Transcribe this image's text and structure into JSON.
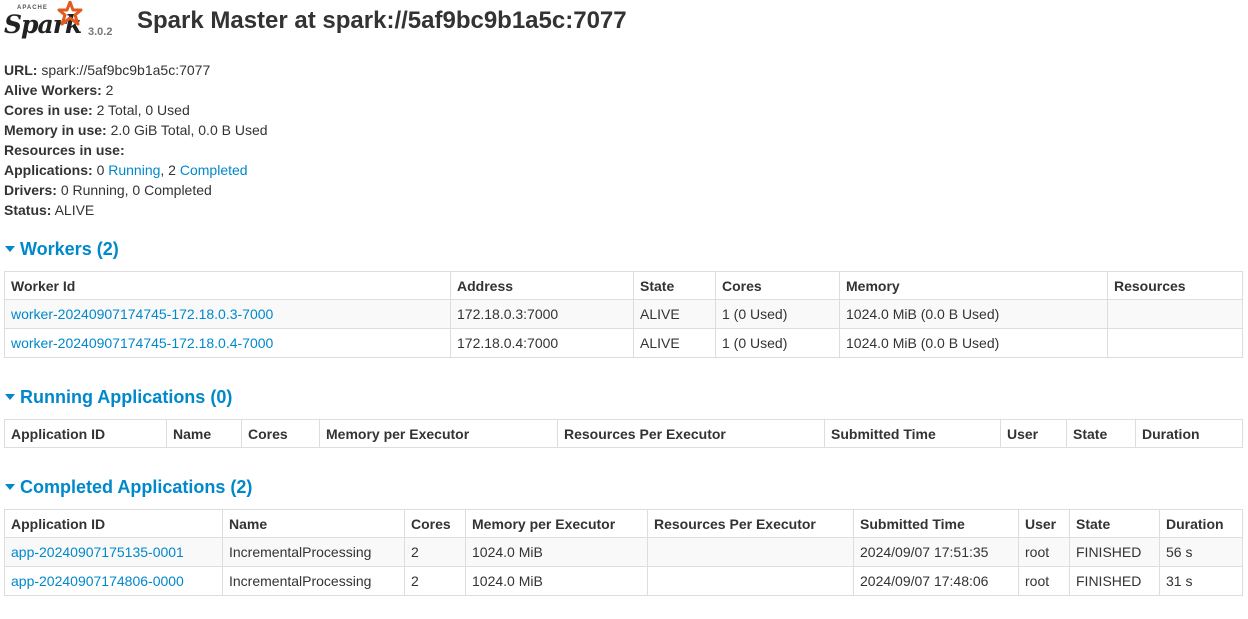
{
  "header": {
    "logo_top": "APACHE",
    "logo_word": "Spark",
    "version": "3.0.2",
    "title": "Spark Master at spark://5af9bc9b1a5c:7077"
  },
  "summary": {
    "url_label": "URL:",
    "url_value": "spark://5af9bc9b1a5c:7077",
    "workers_label": "Alive Workers:",
    "workers_value": "2",
    "cores_label": "Cores in use:",
    "cores_value": "2 Total, 0 Used",
    "memory_label": "Memory in use:",
    "memory_value": "2.0 GiB Total, 0.0 B Used",
    "resources_label": "Resources in use:",
    "apps_label": "Applications:",
    "apps_running_count": "0",
    "apps_running_link": "Running",
    "apps_sep": ", 2",
    "apps_completed_link": "Completed",
    "drivers_label": "Drivers:",
    "drivers_value": "0 Running, 0 Completed",
    "status_label": "Status:",
    "status_value": "ALIVE"
  },
  "workers": {
    "title": "Workers (2)",
    "columns": [
      "Worker Id",
      "Address",
      "State",
      "Cores",
      "Memory",
      "Resources"
    ],
    "rows": [
      [
        "worker-20240907174745-172.18.0.3-7000",
        "172.18.0.3:7000",
        "ALIVE",
        "1 (0 Used)",
        "1024.0 MiB (0.0 B Used)",
        ""
      ],
      [
        "worker-20240907174745-172.18.0.4-7000",
        "172.18.0.4:7000",
        "ALIVE",
        "1 (0 Used)",
        "1024.0 MiB (0.0 B Used)",
        ""
      ]
    ]
  },
  "running": {
    "title": "Running Applications (0)",
    "columns": [
      "Application ID",
      "Name",
      "Cores",
      "Memory per Executor",
      "Resources Per Executor",
      "Submitted Time",
      "User",
      "State",
      "Duration"
    ]
  },
  "completed": {
    "title": "Completed Applications (2)",
    "columns": [
      "Application ID",
      "Name",
      "Cores",
      "Memory per Executor",
      "Resources Per Executor",
      "Submitted Time",
      "User",
      "State",
      "Duration"
    ],
    "rows": [
      [
        "app-20240907175135-0001",
        "IncrementalProcessing",
        "2",
        "1024.0 MiB",
        "",
        "2024/09/07 17:51:35",
        "root",
        "FINISHED",
        "56 s"
      ],
      [
        "app-20240907174806-0000",
        "IncrementalProcessing",
        "2",
        "1024.0 MiB",
        "",
        "2024/09/07 17:48:06",
        "root",
        "FINISHED",
        "31 s"
      ]
    ]
  },
  "colors": {
    "link": "#0088cc",
    "text": "#333333",
    "logo_star": "#e25a1c"
  }
}
